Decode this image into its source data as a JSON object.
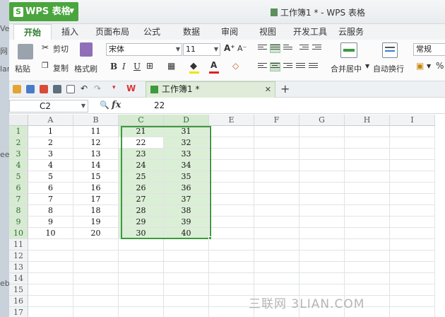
{
  "desktop": {
    "edge_texts": [
      "Ve",
      "网",
      "lan",
      "ee",
      "eb"
    ]
  },
  "app": {
    "menu_label": "WPS 表格",
    "window_title": "工作簿1 * - WPS 表格"
  },
  "ribbon_tabs": [
    "开始",
    "插入",
    "页面布局",
    "公式",
    "数据",
    "审阅",
    "视图",
    "开发工具",
    "云服务"
  ],
  "ribbon": {
    "paste": "粘贴",
    "cut": "剪切",
    "copy": "复制",
    "format_painter": "格式刷",
    "font_name": "宋体",
    "font_size": "11",
    "bold": "B",
    "italic": "I",
    "underline": "U",
    "merge_center": "合并居中",
    "wrap_text": "自动换行",
    "number_format": "常规",
    "percent": "%"
  },
  "doc_tab": {
    "label": "工作簿1 *"
  },
  "formula_bar": {
    "name_box": "C2",
    "fx": "fx",
    "value": "22"
  },
  "sheet": {
    "columns": [
      "A",
      "B",
      "C",
      "D",
      "E",
      "F",
      "G",
      "H",
      "I"
    ],
    "rows": [
      "1",
      "2",
      "3",
      "4",
      "5",
      "6",
      "7",
      "8",
      "9",
      "10",
      "11",
      "12",
      "13",
      "14",
      "15",
      "16",
      "17"
    ],
    "data": [
      [
        "1",
        "11",
        "21",
        "31"
      ],
      [
        "2",
        "12",
        "22",
        "32"
      ],
      [
        "3",
        "13",
        "23",
        "33"
      ],
      [
        "4",
        "14",
        "24",
        "34"
      ],
      [
        "5",
        "15",
        "25",
        "35"
      ],
      [
        "6",
        "16",
        "26",
        "36"
      ],
      [
        "7",
        "17",
        "27",
        "37"
      ],
      [
        "8",
        "18",
        "28",
        "38"
      ],
      [
        "9",
        "19",
        "29",
        "39"
      ],
      [
        "10",
        "20",
        "30",
        "40"
      ]
    ]
  },
  "watermark": "三联网 3LIAN.COM"
}
